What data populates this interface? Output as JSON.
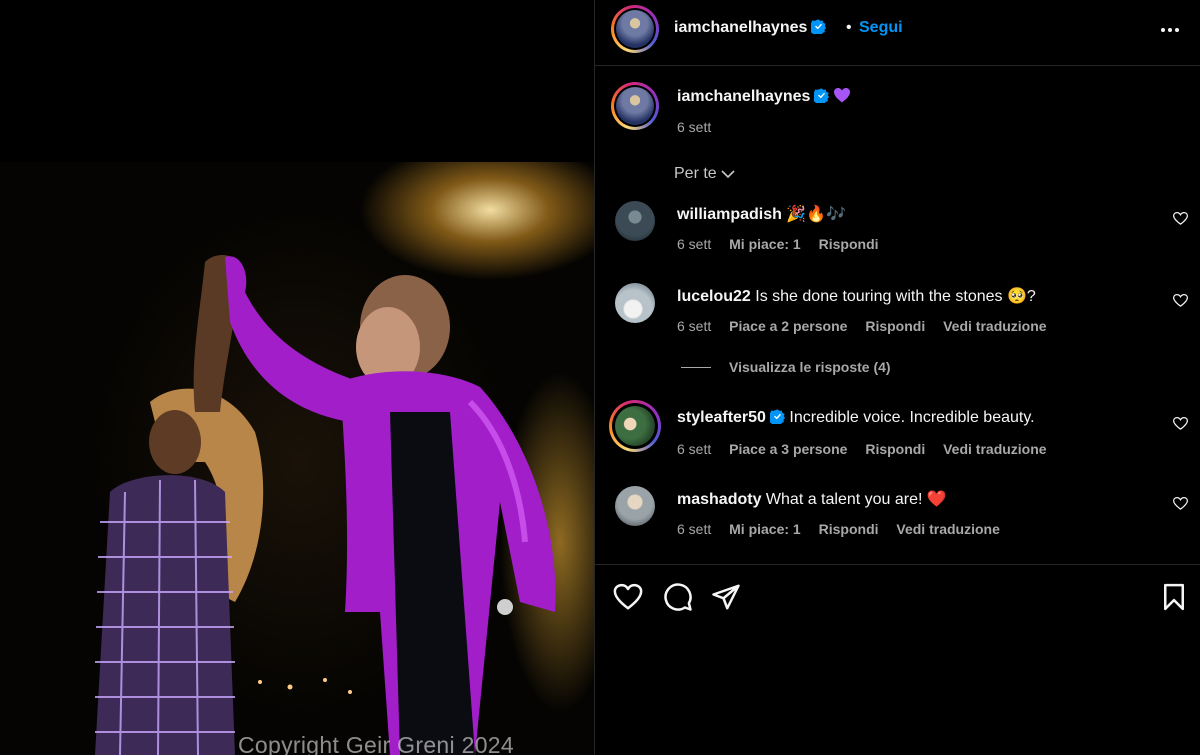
{
  "header": {
    "username": "iamchanelhaynes",
    "separator": "•",
    "follow_label": "Segui"
  },
  "caption": {
    "username": "iamchanelhaynes",
    "date": "6 sett"
  },
  "comments_sort": {
    "label": "Per te"
  },
  "comments": [
    {
      "username": "williampadish",
      "text": "🎉🔥🎶",
      "date": "6 sett",
      "likes": "Mi piace: 1",
      "reply": "Rispondi",
      "translate": ""
    },
    {
      "username": "lucelou22",
      "text": "Is she done touring with the stones 🥺?",
      "date": "6 sett",
      "likes": "Piace a 2 persone",
      "reply": "Rispondi",
      "translate": "Vedi traduzione"
    },
    {
      "username": "styleafter50",
      "text": "Incredible voice. Incredible beauty.",
      "date": "6 sett",
      "likes": "Piace a 3 persone",
      "reply": "Rispondi",
      "translate": "Vedi traduzione"
    },
    {
      "username": "mashadoty",
      "text": "What a talent you are! ❤️",
      "date": "6 sett",
      "likes": "Mi piace: 1",
      "reply": "Rispondi",
      "translate": "Vedi traduzione"
    }
  ],
  "view_replies": {
    "label": "Visualizza le risposte (4)"
  },
  "media": {
    "watermark": "Copyright Geir Greni 2024"
  },
  "colors": {
    "accent": "#0095f6",
    "verified": "#0095f6",
    "shirt": "#a11ec8"
  },
  "icons": {
    "actions": [
      "heart-icon",
      "comment-icon",
      "share-icon",
      "bookmark-icon"
    ]
  }
}
